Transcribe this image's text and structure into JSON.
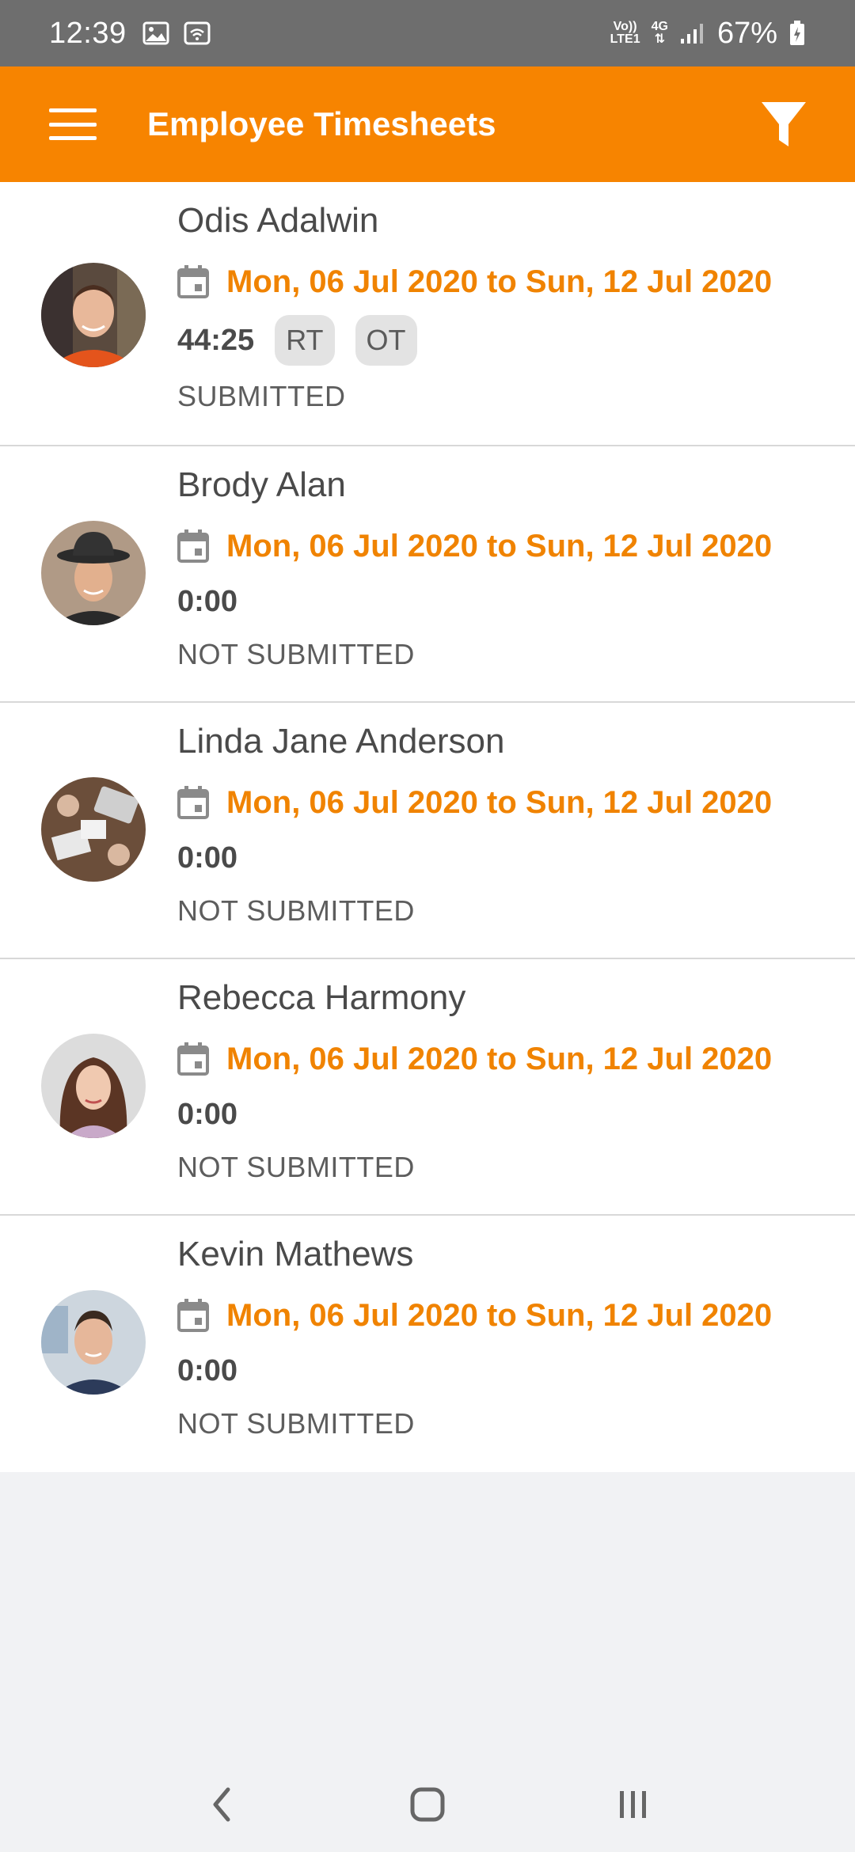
{
  "status_bar": {
    "time": "12:39",
    "network_top": "Vo))",
    "network_bottom": "LTE1",
    "net_type": "4G",
    "battery": "67%"
  },
  "app_bar": {
    "title": "Employee Timesheets",
    "menu_icon": "menu-icon",
    "filter_icon": "filter-icon"
  },
  "colors": {
    "accent": "#f78400",
    "period_text": "#f08300",
    "status_bar": "#6e6e6e"
  },
  "employees": [
    {
      "name": "Odis Adalwin",
      "period": "Mon, 06 Jul 2020 to Sun, 12 Jul 2020",
      "hours": "44:25",
      "chips": [
        "RT",
        "OT"
      ],
      "status": "SUBMITTED"
    },
    {
      "name": "Brody Alan",
      "period": "Mon, 06 Jul 2020 to Sun, 12 Jul 2020",
      "hours": "0:00",
      "chips": [],
      "status": "NOT SUBMITTED"
    },
    {
      "name": "Linda Jane Anderson",
      "period": "Mon, 06 Jul 2020 to Sun, 12 Jul 2020",
      "hours": "0:00",
      "chips": [],
      "status": "NOT SUBMITTED"
    },
    {
      "name": "Rebecca Harmony",
      "period": "Mon, 06 Jul 2020 to Sun, 12 Jul 2020",
      "hours": "0:00",
      "chips": [],
      "status": "NOT SUBMITTED"
    },
    {
      "name": "Kevin Mathews",
      "period": "Mon, 06 Jul 2020 to Sun, 12 Jul 2020",
      "hours": "0:00",
      "chips": [],
      "status": "NOT SUBMITTED"
    }
  ],
  "nav_bar": {
    "back_icon": "back-icon",
    "home_icon": "home-icon",
    "recents_icon": "recents-icon"
  }
}
